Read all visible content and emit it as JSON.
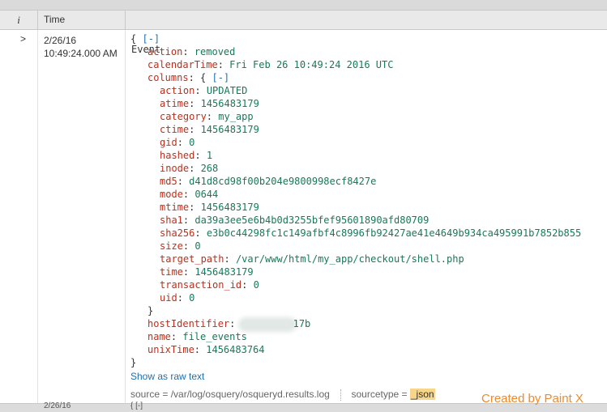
{
  "header": {
    "info": "i",
    "time": "Time",
    "event": "Event"
  },
  "row": {
    "expand_glyph": ">",
    "date": "2/26/16",
    "time": "10:49:24.000 AM",
    "open_brace": "{",
    "collapse": "[-]",
    "action_key": "action",
    "action_val": "removed",
    "calendar_key": "calendarTime",
    "calendar_val": "Fri Feb 26 10:49:24 2016 UTC",
    "columns_key": "columns",
    "columns": [
      {
        "k": "action",
        "v": "UPDATED"
      },
      {
        "k": "atime",
        "v": "1456483179"
      },
      {
        "k": "category",
        "v": "my_app"
      },
      {
        "k": "ctime",
        "v": "1456483179"
      },
      {
        "k": "gid",
        "v": "0"
      },
      {
        "k": "hashed",
        "v": "1"
      },
      {
        "k": "inode",
        "v": "268"
      },
      {
        "k": "md5",
        "v": "d41d8cd98f00b204e9800998ecf8427e"
      },
      {
        "k": "mode",
        "v": "0644"
      },
      {
        "k": "mtime",
        "v": "1456483179"
      },
      {
        "k": "sha1",
        "v": "da39a3ee5e6b4b0d3255bfef95601890afd80709"
      },
      {
        "k": "sha256",
        "v": "e3b0c44298fc1c149afbf4c8996fb92427ae41e4649b934ca495991b7852b855"
      },
      {
        "k": "size",
        "v": "0"
      },
      {
        "k": "target_path",
        "v": "/var/www/html/my_app/checkout/shell.php"
      },
      {
        "k": "time",
        "v": "1456483179"
      },
      {
        "k": "transaction_id",
        "v": "0"
      },
      {
        "k": "uid",
        "v": "0"
      }
    ],
    "close_brace": "}",
    "host_key": "hostIdentifier",
    "host_val": "17b",
    "name_key": "name",
    "name_val": "file_events",
    "unix_key": "unixTime",
    "unix_val": "1456483764",
    "raw_link": "Show as raw text",
    "source_label": "source = ",
    "source_val": "/var/log/osquery/osqueryd.results.log",
    "sourcetype_label": "sourcetype = ",
    "sourcetype_val": "_json"
  },
  "next_row": {
    "date": "2/26/16",
    "brace": "{ [-]"
  },
  "watermark": "Created by Paint X"
}
